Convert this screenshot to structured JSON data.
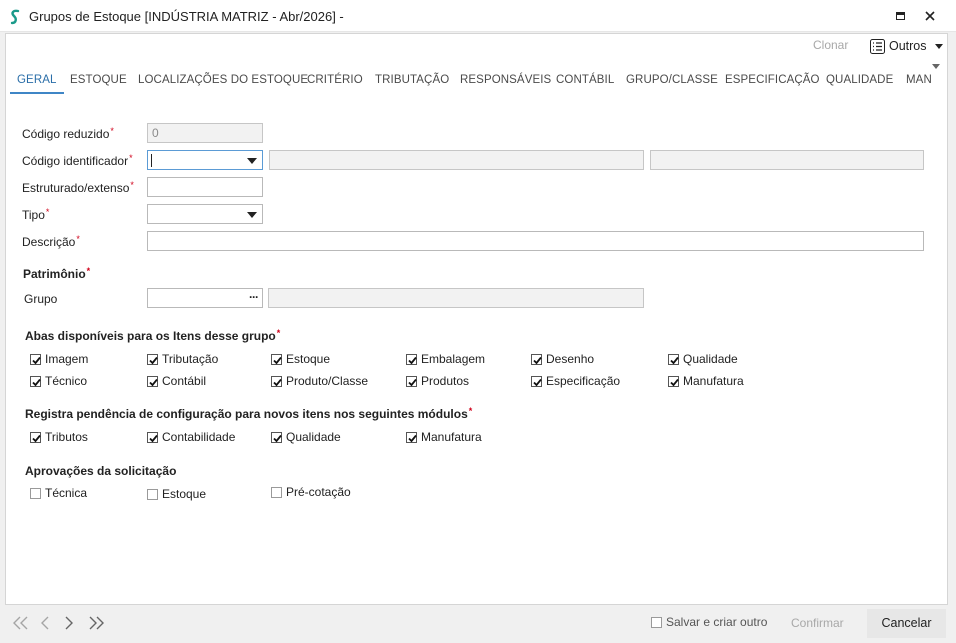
{
  "window": {
    "title": "Grupos de Estoque [INDÚSTRIA MATRIZ - Abr/2026]  -"
  },
  "toolbar": {
    "clonar_label": "Clonar",
    "outros_label": "Outros"
  },
  "tabs": [
    {
      "label": "GERAL"
    },
    {
      "label": "ESTOQUE"
    },
    {
      "label": "LOCALIZAÇÕES DO ESTOQUE"
    },
    {
      "label": "CRITÉRIO"
    },
    {
      "label": "TRIBUTAÇÃO"
    },
    {
      "label": "RESPONSÁVEIS"
    },
    {
      "label": "CONTÁBIL"
    },
    {
      "label": "GRUPO/CLASSE"
    },
    {
      "label": "ESPECIFICAÇÃO"
    },
    {
      "label": "QUALIDADE"
    },
    {
      "label": "MAN"
    }
  ],
  "form": {
    "codigo_reduzido": {
      "label": "Código reduzido",
      "value": "0"
    },
    "codigo_identificador": {
      "label": "Código identificador"
    },
    "estruturado": {
      "label": "Estruturado/extenso"
    },
    "tipo": {
      "label": "Tipo"
    },
    "descricao": {
      "label": "Descrição"
    }
  },
  "patrimonio": {
    "title": "Patrimônio",
    "grupo_label": "Grupo",
    "ellipsis": "···"
  },
  "abas": {
    "title": "Abas disponíveis para os Itens desse grupo",
    "items": [
      {
        "label": "Imagem",
        "checked": true
      },
      {
        "label": "Tributação",
        "checked": true
      },
      {
        "label": "Estoque",
        "checked": true
      },
      {
        "label": "Embalagem",
        "checked": true
      },
      {
        "label": "Desenho",
        "checked": true
      },
      {
        "label": "Qualidade",
        "checked": true
      },
      {
        "label": "Técnico",
        "checked": true
      },
      {
        "label": "Contábil",
        "checked": true
      },
      {
        "label": "Produto/Classe",
        "checked": true
      },
      {
        "label": "Produtos",
        "checked": true
      },
      {
        "label": "Especificação",
        "checked": true
      },
      {
        "label": "Manufatura",
        "checked": true
      }
    ]
  },
  "pendencia": {
    "title": "Registra pendência de configuração para novos itens nos seguintes módulos",
    "items": [
      {
        "label": "Tributos",
        "checked": true
      },
      {
        "label": "Contabilidade",
        "checked": true
      },
      {
        "label": "Qualidade",
        "checked": true
      },
      {
        "label": "Manufatura",
        "checked": true
      }
    ]
  },
  "aprovacoes": {
    "title": "Aprovações da solicitação",
    "items": [
      {
        "label": "Técnica",
        "checked": false
      },
      {
        "label": "Estoque",
        "checked": false
      },
      {
        "label": "Pré-cotação",
        "checked": false
      }
    ]
  },
  "footer": {
    "salvar_label": "Salvar e criar outro",
    "salvar_checked": false,
    "confirmar_label": "Confirmar",
    "cancelar_label": "Cancelar"
  },
  "colors": {
    "accent": "#2a6ea8",
    "required": "#d0021b",
    "app_icon": "#1a9a8a"
  }
}
